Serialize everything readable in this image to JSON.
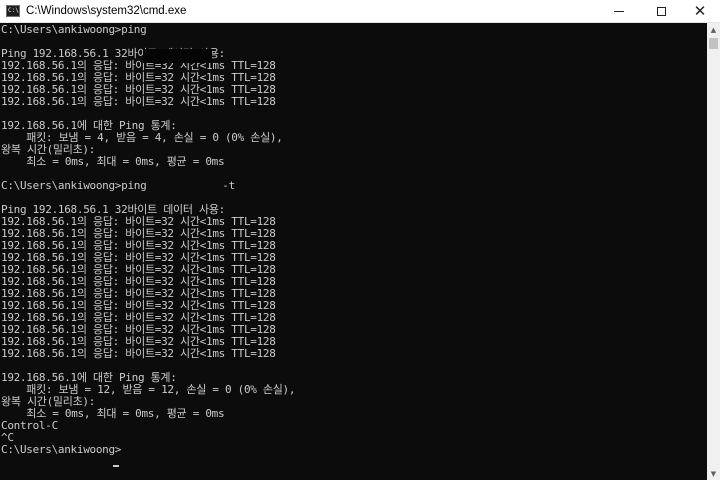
{
  "window": {
    "title": "C:\\Windows\\system32\\cmd.exe",
    "app_icon_text": "C:\\"
  },
  "controls": {
    "minimize": "minimize",
    "maximize": "maximize",
    "close": "✕"
  },
  "scrollbar": {
    "up_arrow": "▲",
    "down_arrow": "▼"
  },
  "terminal": {
    "text": "C:\\Users\\ankiwoong>ping\n\nPing 192.168.56.1 32바이트 데이터 사용:\n192.168.56.1의 응답: 바이트=32 시간<1ms TTL=128\n192.168.56.1의 응답: 바이트=32 시간<1ms TTL=128\n192.168.56.1의 응답: 바이트=32 시간<1ms TTL=128\n192.168.56.1의 응답: 바이트=32 시간<1ms TTL=128\n\n192.168.56.1에 대한 Ping 통계:\n    패킷: 보냄 = 4, 받음 = 4, 손실 = 0 (0% 손실),\n왕복 시간(밀리초):\n    최소 = 0ms, 최대 = 0ms, 평균 = 0ms\n\nC:\\Users\\ankiwoong>ping            -t\n\nPing 192.168.56.1 32바이트 데이터 사용:\n192.168.56.1의 응답: 바이트=32 시간<1ms TTL=128\n192.168.56.1의 응답: 바이트=32 시간<1ms TTL=128\n192.168.56.1의 응답: 바이트=32 시간<1ms TTL=128\n192.168.56.1의 응답: 바이트=32 시간<1ms TTL=128\n192.168.56.1의 응답: 바이트=32 시간<1ms TTL=128\n192.168.56.1의 응답: 바이트=32 시간<1ms TTL=128\n192.168.56.1의 응답: 바이트=32 시간<1ms TTL=128\n192.168.56.1의 응답: 바이트=32 시간<1ms TTL=128\n192.168.56.1의 응답: 바이트=32 시간<1ms TTL=128\n192.168.56.1의 응답: 바이트=32 시간<1ms TTL=128\n192.168.56.1의 응답: 바이트=32 시간<1ms TTL=128\n192.168.56.1의 응답: 바이트=32 시간<1ms TTL=128\n\n192.168.56.1에 대한 Ping 통계:\n    패킷: 보냄 = 12, 받음 = 12, 손실 = 0 (0% 손실),\n왕복 시간(밀리초):\n    최소 = 0ms, 최대 = 0ms, 평균 = 0ms\nControl-C\n^C\nC:\\Users\\ankiwoong>"
  },
  "colors": {
    "console_background": "#0c0c0c",
    "console_text": "#cccccc",
    "titlebar_background": "#ffffff",
    "scrollbar_track": "#f0f0f0",
    "scrollbar_thumb": "#c2c2c2"
  }
}
